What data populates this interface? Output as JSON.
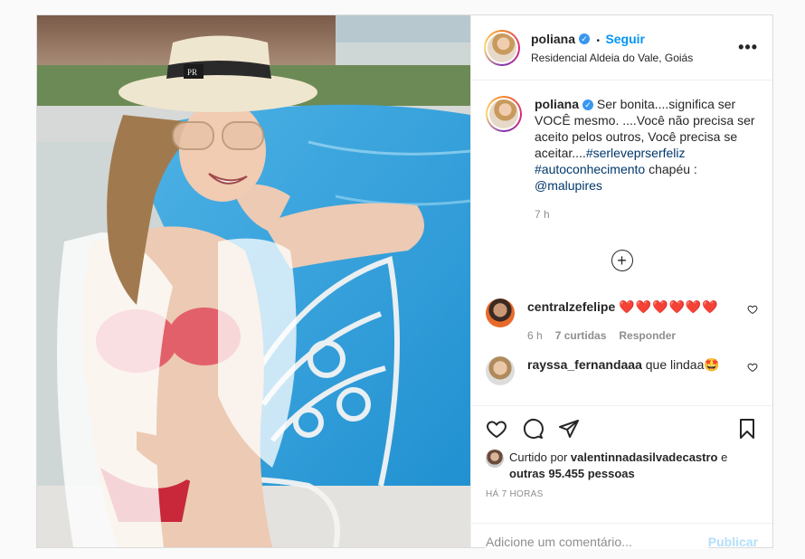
{
  "colors": {
    "accent": "#0095f6",
    "verified": "#3897f0",
    "muted": "#8e8e8e",
    "heart": "#ed4956",
    "publish_disabled": "#b2dffc"
  },
  "header": {
    "username": "poliana",
    "separator": "•",
    "follow_label": "Seguir",
    "location": "Residencial Aldeia do Vale, Goiás",
    "more_icon": "ellipsis-icon",
    "more_label": "•••"
  },
  "caption": {
    "username": "poliana",
    "text": "Ser bonita....significa ser VOCÊ mesmo. ....Você não precisa ser aceito pelos outros, Você precisa se aceitar....",
    "hashtag1": "#serleveprserfeliz",
    "hashtag2": "#autoconhecimento",
    "after_hashtags": " chapéu : ",
    "mention": "@malupires",
    "time": "7 h"
  },
  "load_more_label": "+",
  "comments": [
    {
      "username": "centralzefelipe",
      "text": "❤️❤️❤️❤️❤️❤️",
      "time": "6 h",
      "likes": "7 curtidas",
      "reply": "Responder"
    },
    {
      "username": "rayssa_fernandaaa",
      "text": "que lindaa🤩"
    }
  ],
  "likes": {
    "prefix": "Curtido por ",
    "user": "valentinnadasilvadecastro",
    "middle": " e ",
    "others": "outras 95.455 pessoas"
  },
  "posted_ago": "HÁ 7 HORAS",
  "add_comment": {
    "placeholder": "Adicione um comentário...",
    "publish_label": "Publicar"
  }
}
